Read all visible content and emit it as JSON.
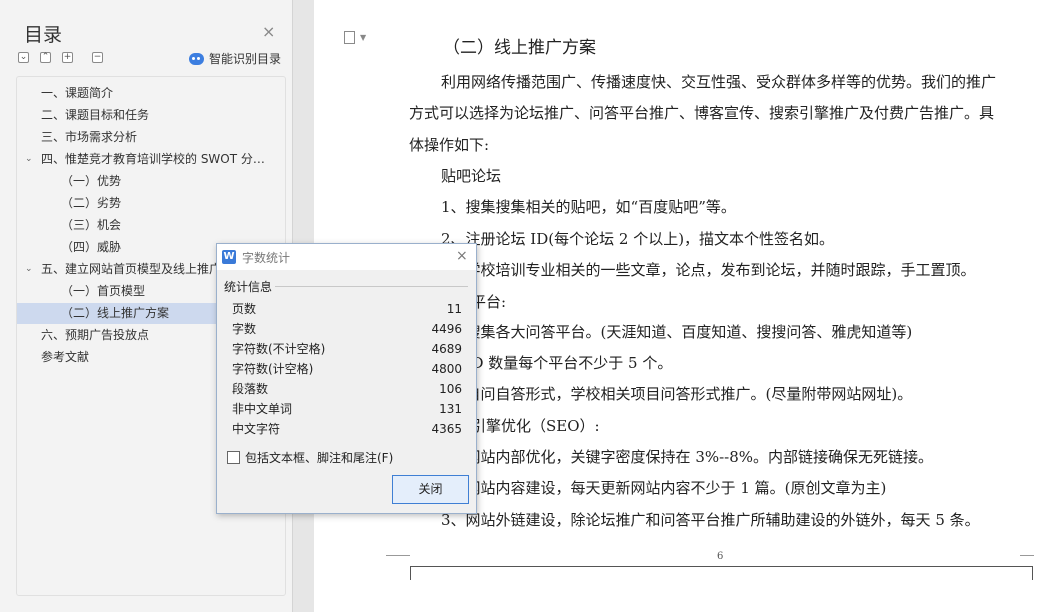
{
  "toc": {
    "title": "目录",
    "close_glyph": "×",
    "smart_toc_label": "智能识别目录",
    "items": [
      {
        "label": "一、课题简介",
        "level": 0
      },
      {
        "label": "二、课题目标和任务",
        "level": 0
      },
      {
        "label": "三、市场需求分析",
        "level": 0
      },
      {
        "label": "四、惟楚竞才教育培训学校的 SWOT 分…",
        "level": 0,
        "expanded": true
      },
      {
        "label": "（一）优势",
        "level": 1
      },
      {
        "label": "（二）劣势",
        "level": 1
      },
      {
        "label": "（三）机会",
        "level": 1
      },
      {
        "label": "（四）威胁",
        "level": 1
      },
      {
        "label": "五、建立网站首页模型及线上推广",
        "level": 0,
        "expanded": true
      },
      {
        "label": "（一）首页模型",
        "level": 1
      },
      {
        "label": "（二）线上推广方案",
        "level": 1,
        "selected": true
      },
      {
        "label": "六、预期广告投放点",
        "level": 0
      },
      {
        "label": "参考文献",
        "level": 0
      }
    ]
  },
  "document": {
    "heading": "（二）线上推广方案",
    "paragraphs": [
      "利用网络传播范围广、传播速度快、交互性强、受众群体多样等的优势。我们的推广",
      "方式可以选择为论坛推广、问答平台推广、博客宣传、搜索引擎推广及付费广告推广。具",
      "体操作如下:",
      "贴吧论坛",
      "1、搜集搜集相关的贴吧，如“百度贴吧”等。",
      "2、注册论坛 ID(每个论坛 2 个以上)，描文本个性签名如。",
      "3、学校培训专业相关的一些文章，论点，发布到论坛，并随时跟踪，手工置顶。",
      "问答平台:",
      "1、搜集各大问答平台。(天涯知道、百度知道、搜搜问答、雅虎知道等)",
      "2、ID 数量每个平台不少于 5 个。",
      "3、自问自答形式，学校相关项目问答形式推广。(尽量附带网站网址)。",
      "搜索引擎优化（SEO）:",
      "1、网站内部优化，关键字密度保持在 3%--8%。内部链接确保无死链接。",
      "2、网站内容建设，每天更新网站内容不少于 1 篇。(原创文章为主)",
      "3、网站外链建设，除论坛推广和问答平台推广所辅助建设的外链外，每天 5 条。"
    ],
    "page_number": "6"
  },
  "dialog": {
    "title": "字数统计",
    "close_glyph": "×",
    "group_label": "统计信息",
    "stats": [
      {
        "label": "页数",
        "value": "11"
      },
      {
        "label": "字数",
        "value": "4496"
      },
      {
        "label": "字符数(不计空格)",
        "value": "4689"
      },
      {
        "label": "字符数(计空格)",
        "value": "4800"
      },
      {
        "label": "段落数",
        "value": "106"
      },
      {
        "label": "非中文单词",
        "value": "131"
      },
      {
        "label": "中文字符",
        "value": "4365"
      }
    ],
    "checkbox_label": "包括文本框、脚注和尾注(F)",
    "checkbox_checked": false,
    "ok_label": "关闭"
  },
  "colors": {
    "accent": "#3a7ad8",
    "toc_selected": "#cdd9ee",
    "dialog_border": "#9ab0cc"
  }
}
